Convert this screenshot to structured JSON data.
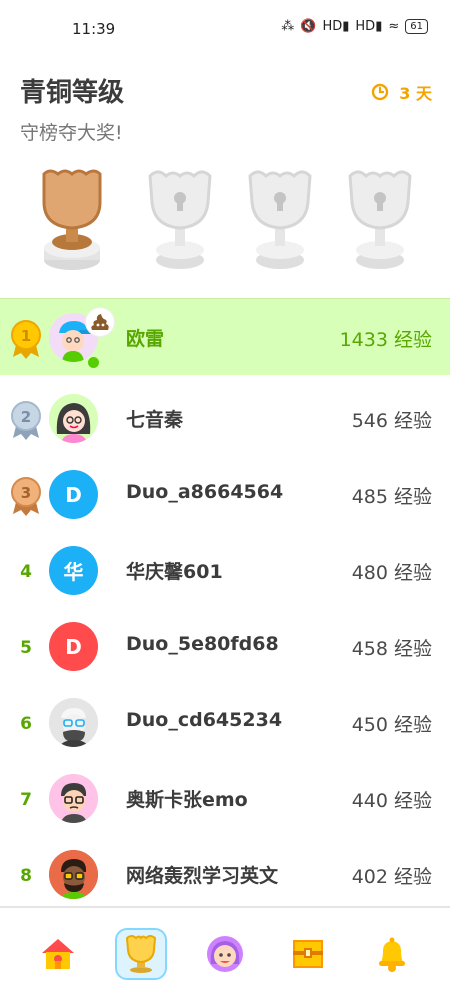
{
  "status_bar": {
    "time": "11:39",
    "signal_text": "HD",
    "battery": "61"
  },
  "header": {
    "league_title": "青铜等级",
    "subtitle": "守榜夺大奖!",
    "timer_text": "3 天",
    "timer_color": "#f5a300"
  },
  "leaderboard": {
    "xp_unit": "经验",
    "rows": [
      {
        "rank": "1",
        "name": "欧雷",
        "xp": "1433 经验",
        "avatar_letter": "",
        "avatar_color": "#f3dcf7",
        "highlight": true
      },
      {
        "rank": "2",
        "name": "七音秦",
        "xp": "546 经验",
        "avatar_letter": "",
        "avatar_color": "#d7ffb8"
      },
      {
        "rank": "3",
        "name": "Duo_a8664564",
        "xp": "485 经验",
        "avatar_letter": "D",
        "avatar_color": "#1cb0f6"
      },
      {
        "rank": "4",
        "name": "华庆馨601",
        "xp": "480 经验",
        "avatar_letter": "华",
        "avatar_color": "#1cb0f6"
      },
      {
        "rank": "5",
        "name": "Duo_5e80fd68",
        "xp": "458 经验",
        "avatar_letter": "D",
        "avatar_color": "#ff4b4b"
      },
      {
        "rank": "6",
        "name": "Duo_cd645234",
        "xp": "450 经验",
        "avatar_letter": "",
        "avatar_color": "#e5e5e5"
      },
      {
        "rank": "7",
        "name": "奥斯卡张emo",
        "xp": "440 经验",
        "avatar_letter": "",
        "avatar_color": "#ffc3e8"
      },
      {
        "rank": "8",
        "name": "网络轰烈学习英文",
        "xp": "402 经验",
        "avatar_letter": "",
        "avatar_color": "#ea6b48"
      }
    ]
  },
  "colors": {
    "accent_green": "#58a700",
    "highlight_bg": "#d7ffb8",
    "gold": "#ffc800",
    "silver": "#a5b8cc",
    "bronze": "#d48a4b"
  },
  "bottom_nav": [
    {
      "icon": "home-icon",
      "active": false
    },
    {
      "icon": "leaderboard-trophy-icon",
      "active": true
    },
    {
      "icon": "profile-icon",
      "active": false
    },
    {
      "icon": "treasure-chest-icon",
      "active": false
    },
    {
      "icon": "notifications-bell-icon",
      "active": false
    }
  ]
}
